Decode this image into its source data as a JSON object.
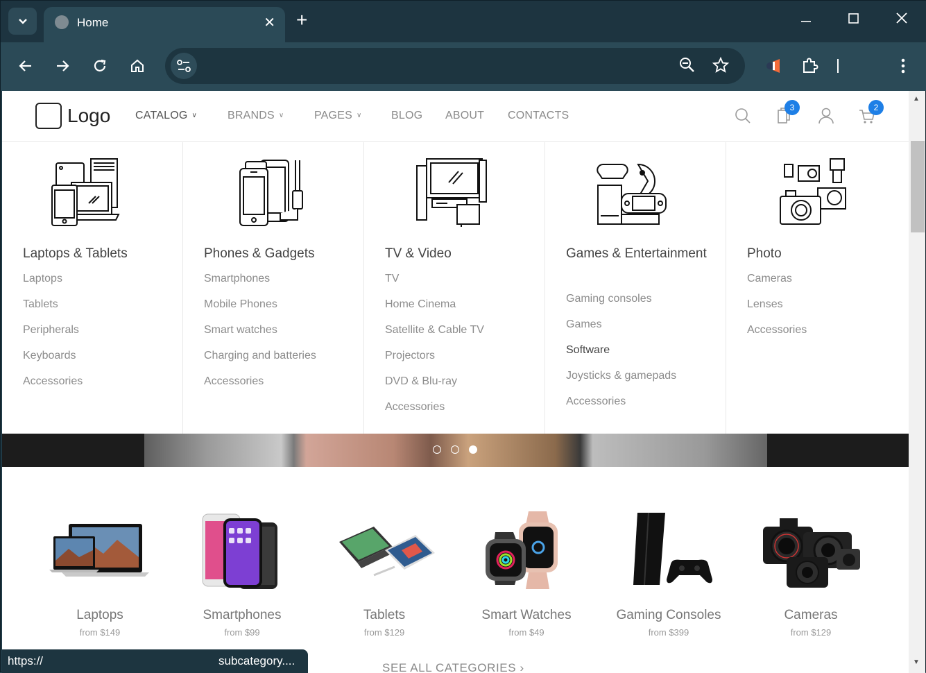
{
  "browser": {
    "tab_title": "Home",
    "window_buttons": [
      "minimize",
      "maximize",
      "close"
    ],
    "status_url_left": "https://",
    "status_url_right": "subcategory...."
  },
  "site": {
    "logo": "Logo",
    "nav": [
      {
        "label": "CATALOG",
        "dropdown": true
      },
      {
        "label": "BRANDS",
        "dropdown": true
      },
      {
        "label": "PAGES",
        "dropdown": true
      },
      {
        "label": "BLOG",
        "dropdown": false
      },
      {
        "label": "ABOUT",
        "dropdown": false
      },
      {
        "label": "CONTACTS",
        "dropdown": false
      }
    ],
    "compare_count": "3",
    "cart_count": "2"
  },
  "mega_menu": [
    {
      "title": "Laptops & Tablets",
      "links": [
        "Laptops",
        "Tablets",
        "Peripherals",
        "Keyboards",
        "Accessories"
      ]
    },
    {
      "title": "Phones & Gadgets",
      "links": [
        "Smartphones",
        "Mobile Phones",
        "Smart watches",
        "Charging and batteries",
        "Accessories"
      ]
    },
    {
      "title": "TV & Video",
      "links": [
        "TV",
        "Home Cinema",
        "Satellite & Cable TV",
        "Projectors",
        "DVD & Blu-ray",
        "Accessories"
      ]
    },
    {
      "title": "Games & Entertainment",
      "links": [
        "Gaming consoles",
        "Games",
        "Software",
        "Joysticks & gamepads",
        "Accessories"
      ]
    },
    {
      "title": "Photo",
      "links": [
        "Cameras",
        "Lenses",
        "Accessories"
      ]
    }
  ],
  "slider": {
    "dots": 3,
    "active": 3
  },
  "categories": [
    {
      "name": "Laptops",
      "price": "from $149"
    },
    {
      "name": "Smartphones",
      "price": "from $99"
    },
    {
      "name": "Tablets",
      "price": "from $129"
    },
    {
      "name": "Smart Watches",
      "price": "from $49"
    },
    {
      "name": "Gaming Consoles",
      "price": "from $399"
    },
    {
      "name": "Cameras",
      "price": "from $129"
    }
  ],
  "see_all": "SEE ALL CATEGORIES ›"
}
